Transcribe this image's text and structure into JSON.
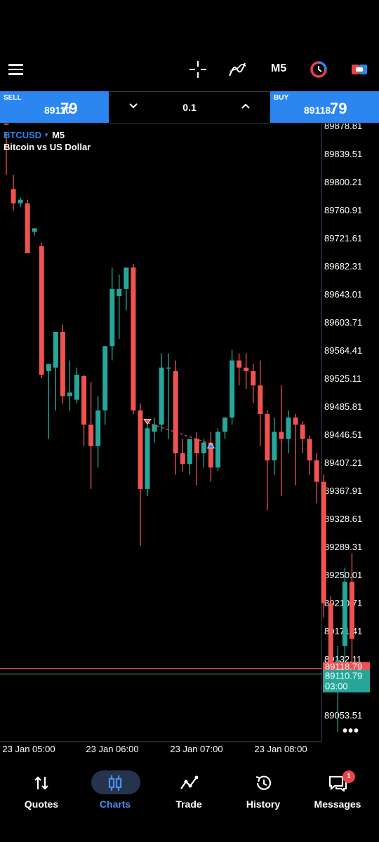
{
  "toolbar": {
    "menu_icon": "hamburger-menu-icon",
    "crosshair_icon": "crosshair-icon",
    "indicators_icon": "indicators-icon",
    "timeframe": "M5",
    "chart_type_icon": "chart-type-icon",
    "one_click_icon": "one-click-trading-icon"
  },
  "trade": {
    "sell_label": "SELL",
    "sell_price_main": "89110.",
    "sell_price_big": "79",
    "buy_label": "BUY",
    "buy_price_main": "89118.",
    "buy_price_big": "79",
    "lot": "0.1"
  },
  "chart": {
    "symbol": "BTCUSD",
    "timeframe": "M5",
    "description": "Bitcoin vs US Dollar",
    "price_labels": [
      "89878.81",
      "89839.51",
      "89800.21",
      "89760.91",
      "89721.61",
      "89682.31",
      "89643.01",
      "89603.71",
      "89564.41",
      "89525.11",
      "89485.81",
      "89446.51",
      "89407.21",
      "89367.91",
      "89328.61",
      "89289.31",
      "89250.01",
      "89210.71",
      "89171.41",
      "89132.11",
      "89053.51"
    ],
    "ask_tag": "89118.79",
    "bid_tag": "89110.79",
    "timer": "03:00",
    "time_labels": [
      "23 Jan 05:00",
      "23 Jan 06:00",
      "23 Jan 07:00",
      "23 Jan 08:00"
    ],
    "colors": {
      "up": "#26a69a",
      "down": "#ef5350",
      "accent": "#2b86f0"
    }
  },
  "chart_data": {
    "type": "candlestick",
    "ylim": [
      89030,
      89885
    ],
    "candles": [
      [
        89910,
        89870,
        89810,
        89880
      ],
      [
        89790,
        89810,
        89760,
        89770
      ],
      [
        89770,
        89778,
        89765,
        89775
      ],
      [
        89770,
        89775,
        89730,
        89700
      ],
      [
        89730,
        89732,
        89725,
        89735
      ],
      [
        89710,
        89715,
        89525,
        89530
      ],
      [
        89535,
        89545,
        89440,
        89545
      ],
      [
        89540,
        89590,
        89480,
        89590
      ],
      [
        89590,
        89600,
        89490,
        89500
      ],
      [
        89500,
        89550,
        89480,
        89505
      ],
      [
        89495,
        89540,
        89490,
        89530
      ],
      [
        89528,
        89530,
        89430,
        89460
      ],
      [
        89460,
        89520,
        89370,
        89430
      ],
      [
        89430,
        89500,
        89400,
        89480
      ],
      [
        89480,
        89570,
        89460,
        89570
      ],
      [
        89570,
        89680,
        89550,
        89650
      ],
      [
        89640,
        89670,
        89580,
        89650
      ],
      [
        89650,
        89660,
        89620,
        89680
      ],
      [
        89680,
        89685,
        89475,
        89480
      ],
      [
        89480,
        89490,
        89290,
        89370
      ],
      [
        89370,
        89465,
        89360,
        89455
      ],
      [
        89450,
        89470,
        89435,
        89460
      ],
      [
        89460,
        89560,
        89450,
        89540
      ],
      [
        89540,
        89560,
        89440,
        89540
      ],
      [
        89535,
        89550,
        89390,
        89420
      ],
      [
        89420,
        89440,
        89395,
        89405
      ],
      [
        89405,
        89430,
        89390,
        89440
      ],
      [
        89440,
        89450,
        89375,
        89420
      ],
      [
        89420,
        89440,
        89400,
        89435
      ],
      [
        89435,
        89450,
        89380,
        89400
      ],
      [
        89400,
        89455,
        89395,
        89450
      ],
      [
        89450,
        89470,
        89440,
        89470
      ],
      [
        89470,
        89565,
        89460,
        89550
      ],
      [
        89550,
        89560,
        89515,
        89540
      ],
      [
        89540,
        89560,
        89510,
        89535
      ],
      [
        89535,
        89545,
        89490,
        89515
      ],
      [
        89515,
        89550,
        89430,
        89475
      ],
      [
        89475,
        89480,
        89340,
        89410
      ],
      [
        89410,
        89470,
        89390,
        89450
      ],
      [
        89450,
        89515,
        89360,
        89440
      ],
      [
        89440,
        89480,
        89420,
        89470
      ],
      [
        89470,
        89475,
        89375,
        89460
      ],
      [
        89460,
        89465,
        89420,
        89440
      ],
      [
        89440,
        89445,
        89390,
        89410
      ],
      [
        89410,
        89420,
        89350,
        89380
      ],
      [
        89380,
        89390,
        89190,
        89210
      ],
      [
        89210,
        89220,
        89090,
        89120
      ],
      [
        89120,
        89150,
        89030,
        89130
      ],
      [
        89150,
        89260,
        89130,
        89240
      ],
      [
        89240,
        89280,
        89100,
        89160
      ]
    ],
    "sell_marker_index": 20,
    "buy_marker_index": 29,
    "ask": 89118.79,
    "bid": 89110.79
  },
  "nav": {
    "items": [
      {
        "label": "Quotes",
        "icon": "quotes-icon"
      },
      {
        "label": "Charts",
        "icon": "charts-icon"
      },
      {
        "label": "Trade",
        "icon": "trade-icon"
      },
      {
        "label": "History",
        "icon": "history-icon"
      },
      {
        "label": "Messages",
        "icon": "messages-icon"
      }
    ],
    "messages_badge": "1"
  }
}
